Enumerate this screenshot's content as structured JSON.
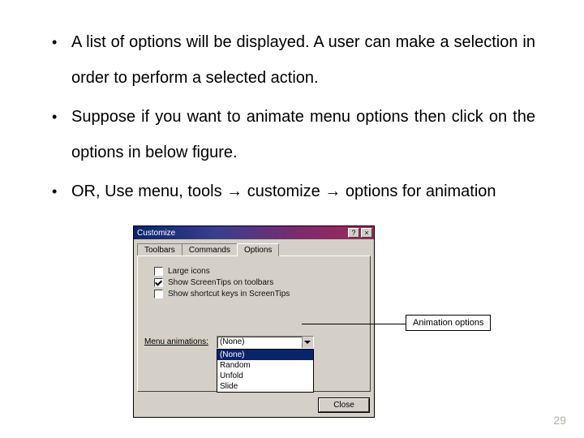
{
  "bullets": {
    "b1": "A list of options will be displayed. A user can make a selection in order to perform a selected action.",
    "b2": "Suppose if you want to animate menu options then click on the options in below figure.",
    "b3": "OR, Use menu, tools → customize → options for animation"
  },
  "page_number": "29",
  "dialog": {
    "title": "Customize",
    "tabs": {
      "t1": "Toolbars",
      "t2": "Commands",
      "t3": "Options"
    },
    "checkboxes": {
      "large_icons": "Large icons",
      "screentips": "Show ScreenTips on toolbars",
      "shortcut": "Show shortcut keys in ScreenTips"
    },
    "menu_anim_label": "Menu animations:",
    "combo_value": "(None)",
    "options": {
      "o1": "(None)",
      "o2": "Random",
      "o3": "Unfold",
      "o4": "Slide"
    },
    "close": "Close"
  },
  "callout": "Animation options"
}
